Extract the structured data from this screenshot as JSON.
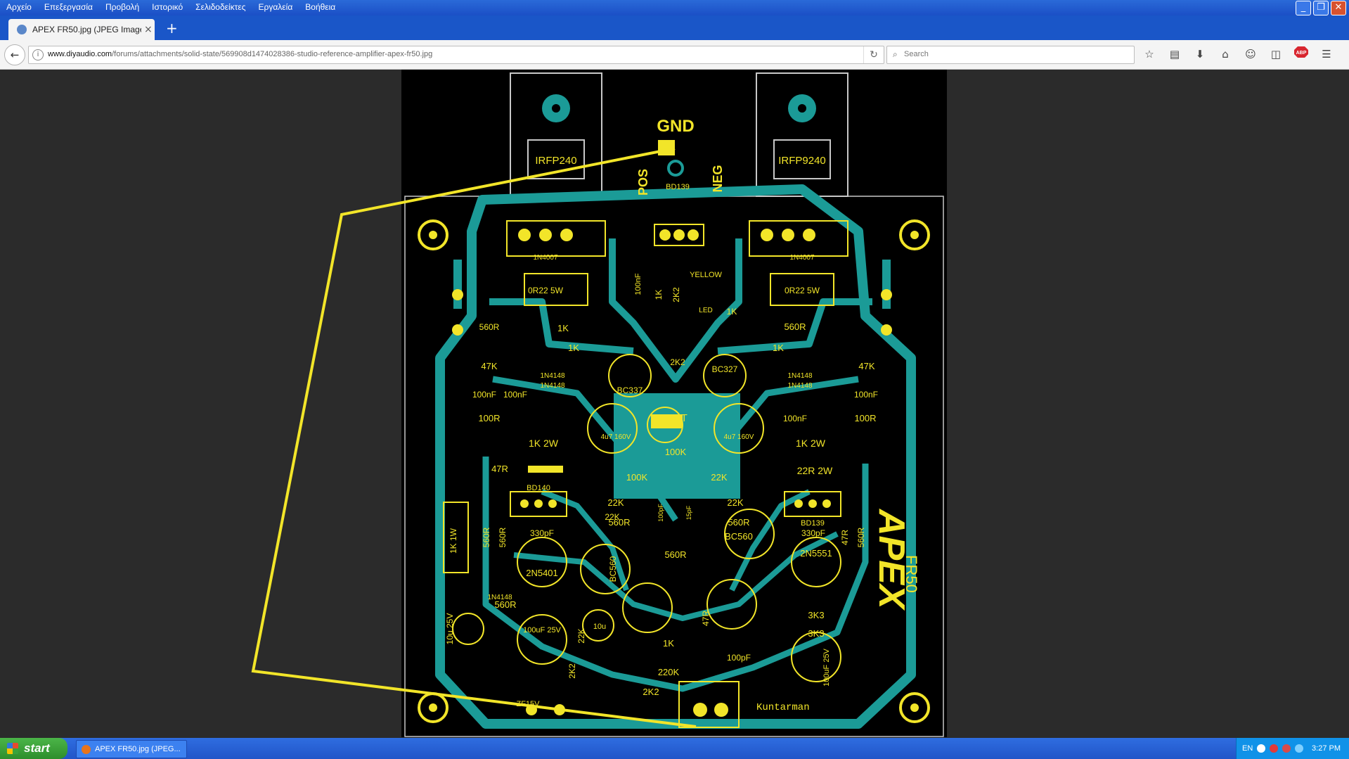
{
  "menu": [
    "Αρχείο",
    "Επεξεργασία",
    "Προβολή",
    "Ιστορικό",
    "Σελιδοδείκτες",
    "Εργαλεία",
    "Βοήθεια"
  ],
  "window_controls": {
    "minimize": "_",
    "restore": "❐",
    "close": "✕"
  },
  "tab": {
    "title": "APEX FR50.jpg (JPEG Image, ...",
    "close": "×",
    "new_tab": "+"
  },
  "address": {
    "host": "www.diyaudio.com",
    "path": "/forums/attachments/solid-state/569908d1474028386-studio-reference-amplifier-apex-fr50.jpg"
  },
  "search": {
    "placeholder": "Search"
  },
  "toolbar_icons": [
    "star-icon",
    "reading-list-icon",
    "download-icon",
    "home-icon",
    "chat-icon",
    "pocket-icon",
    "adblock-icon",
    "menu-icon"
  ],
  "adblock_label": "ABP",
  "pcb": {
    "gnd": "GND",
    "pos": "POS",
    "neg": "NEG",
    "left_mosfet": "IRFP240",
    "right_mosfet": "IRFP9240",
    "driver_top": "BD139",
    "brand": "APEX",
    "model": "FR50",
    "author": "Kuntarman",
    "out": "OUT",
    "parts": [
      "0R22 5W",
      "0R22 5W",
      "1N4007",
      "1N4007",
      "560R",
      "560R",
      "1K",
      "1K",
      "1K",
      "1K",
      "47K",
      "47K",
      "1N4148",
      "1N4148",
      "1N4148",
      "1N4148",
      "100nF",
      "100nF",
      "100nF",
      "100nF",
      "100R",
      "100R",
      "BC337",
      "BC327",
      "4u7 160V",
      "4u7 160V",
      "100K",
      "100K",
      "1K 2W",
      "1K 2W",
      "47R",
      "22R 2W",
      "22K",
      "22K",
      "22K",
      "22K",
      "BD140",
      "BD139",
      "560R",
      "560R",
      "330pF",
      "330pF",
      "2N5401",
      "2N5551",
      "BC560",
      "BC560",
      "560R",
      "1K 1W",
      "560R",
      "560R",
      "47R",
      "560R",
      "3K3",
      "3K3",
      "100uF 25V",
      "10u 25V",
      "100uF 25V",
      "1K",
      "220K",
      "2K2",
      "100pF",
      "ZF15V",
      "47R",
      "2K2",
      "YELLOW",
      "LED",
      "2K2",
      "2K2",
      "1K",
      "100nF",
      "100pF",
      "15pF",
      "560R",
      "1N4148",
      "10u",
      "22K"
    ]
  },
  "taskbar": {
    "start": "start",
    "task": "APEX FR50.jpg (JPEG...",
    "lang": "EN",
    "clock": "3:27 PM"
  }
}
